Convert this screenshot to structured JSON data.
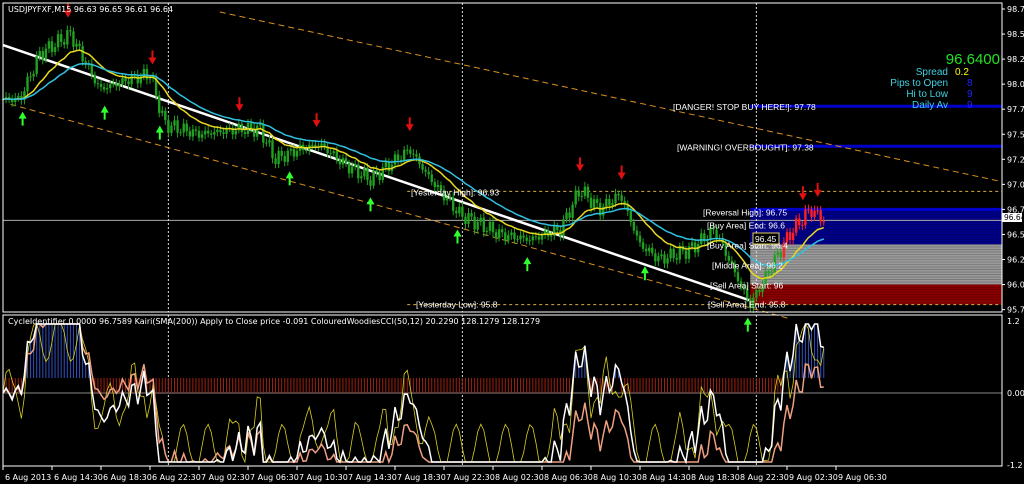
{
  "window": {
    "symbol_header": "USDJPYFXF,M15  96.63 96.65 96.61 96.64"
  },
  "info_panel": {
    "price": "96.6400",
    "rows": [
      {
        "label": "Spread",
        "value": "0.2",
        "color": "#ffff00"
      },
      {
        "label": "Pips to Open",
        "value": "8",
        "color": "#2020ff"
      },
      {
        "label": "Hi to Low",
        "value": "9",
        "color": "#2020ff"
      },
      {
        "label": "Daily Av",
        "value": "9",
        "color": "#2020ff"
      }
    ]
  },
  "indicator_header": "CycleIdentifier 0.0000 96.7589  Kairi(SMA(200)) Apply to Close price -0.091  ColouredWoodiesCCI(50,12) 20.2290 128.1279 128.1279",
  "current_price_tag": "96.64",
  "level_labels": [
    {
      "text": "[DANGER! STOP BUY HERE!]: 97.78",
      "price": 97.78
    },
    {
      "text": "[WARNING! OVERBOUGHT]: 97.38",
      "price": 97.38
    },
    {
      "text": "[Reversal High]: 96.75",
      "price": 96.75
    },
    {
      "text": "[Buy Area] End: 96.6",
      "price": 96.6
    },
    {
      "text": "[Buy Area] Start: 96.4",
      "price": 96.4
    },
    {
      "text": "[Middle Area]: 96.2",
      "price": 96.2
    },
    {
      "text": "[Sell Area] Start: 96",
      "price": 96.0
    },
    {
      "text": "[Sell Area] End: 95.8",
      "price": 95.8
    },
    {
      "text": "[Yesterday High]: 96.93",
      "price": 96.93
    },
    {
      "text": "[Yesterday Low]: 95.8",
      "price": 95.8
    }
  ],
  "box_label": "96.45",
  "chart_data": {
    "type": "line",
    "subtype": "ohlc-bars",
    "title": "USDJPYFXF,M15",
    "ylim": [
      95.7,
      98.8
    ],
    "y_ticks": [
      "98.75",
      "98.50",
      "98.25",
      "98.00",
      "97.75",
      "97.50",
      "97.25",
      "97.00",
      "96.75",
      "96.50",
      "96.25",
      "96.00",
      "95.75"
    ],
    "x_ticks": [
      "6 Aug 2013",
      "6 Aug 14:30",
      "6 Aug 18:30",
      "6 Aug 22:30",
      "7 Aug 02:30",
      "7 Aug 06:30",
      "7 Aug 10:30",
      "7 Aug 14:30",
      "7 Aug 18:30",
      "7 Aug 22:30",
      "8 Aug 02:30",
      "8 Aug 06:30",
      "8 Aug 10:30",
      "8 Aug 14:30",
      "8 Aug 18:30",
      "8 Aug 22:30",
      "9 Aug 02:30",
      "9 Aug 06:30"
    ],
    "x_unit": "hours since 6 Aug 10:30",
    "day_separators_hours": [
      13.5,
      37.5,
      61.5
    ],
    "close_path": [
      [
        0,
        97.85
      ],
      [
        1.4,
        97.85
      ],
      [
        3,
        98.3
      ],
      [
        5.5,
        98.5
      ],
      [
        7.9,
        97.95
      ],
      [
        10.4,
        98.05
      ],
      [
        12,
        98.1
      ],
      [
        13.2,
        97.6
      ],
      [
        16,
        97.5
      ],
      [
        19.3,
        97.55
      ],
      [
        21,
        97.55
      ],
      [
        22.2,
        97.25
      ],
      [
        24.2,
        97.35
      ],
      [
        25.9,
        97.4
      ],
      [
        27.9,
        97.2
      ],
      [
        30,
        97.05
      ],
      [
        31.6,
        97.2
      ],
      [
        33.2,
        97.35
      ],
      [
        34.9,
        97.05
      ],
      [
        37.3,
        96.7
      ],
      [
        40.6,
        96.5
      ],
      [
        43,
        96.45
      ],
      [
        45.5,
        96.55
      ],
      [
        47.1,
        96.95
      ],
      [
        48.7,
        96.75
      ],
      [
        50.4,
        96.9
      ],
      [
        52,
        96.4
      ],
      [
        53.6,
        96.25
      ],
      [
        56.1,
        96.35
      ],
      [
        58.1,
        96.55
      ],
      [
        60.2,
        96.0
      ],
      [
        61,
        95.8
      ],
      [
        62.6,
        96.15
      ],
      [
        64.2,
        96.5
      ],
      [
        65.9,
        96.75
      ],
      [
        67.1,
        96.64
      ]
    ],
    "signals_down": [
      5.3,
      12.2,
      19.3,
      25.6,
      33.2,
      47.1,
      50.5,
      65.3,
      66.5
    ],
    "signals_up": [
      1.6,
      8.3,
      12.8,
      23.4,
      30,
      37.1,
      42.8,
      52.4,
      60.8
    ],
    "trendline": [
      [
        0,
        98.39
      ],
      [
        61,
        95.84
      ]
    ],
    "channel_upper": [
      [
        17.7,
        98.72
      ],
      [
        81.4,
        97.03
      ]
    ],
    "channel_lower": [
      [
        0.6,
        97.8
      ],
      [
        64.2,
        95.66
      ]
    ],
    "zones": [
      {
        "name": "buy-zone",
        "from": 96.4,
        "to": 96.75,
        "color": "#00008b"
      },
      {
        "name": "middle-zone",
        "from": 96.0,
        "to": 96.4,
        "color": "#9a9a9a"
      },
      {
        "name": "sell-zone",
        "from": 95.8,
        "to": 96.0,
        "color": "#8b0000"
      }
    ],
    "indicator": {
      "ylim": [
        -1.2,
        1.2
      ],
      "y_ticks": [
        "1.2",
        "0.00",
        "-1.2"
      ]
    }
  }
}
